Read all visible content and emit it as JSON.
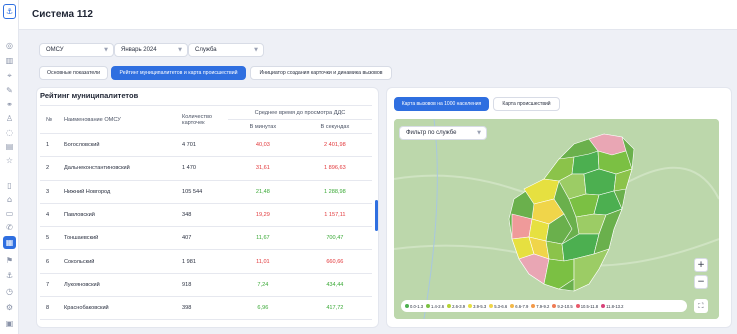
{
  "app": {
    "title": "Система 112"
  },
  "filters": [
    {
      "value": "ОМСУ"
    },
    {
      "value": "Январь 2024"
    },
    {
      "value": "Служба"
    }
  ],
  "tabs": [
    {
      "label": "Основные показатели",
      "active": false
    },
    {
      "label": "Рейтинг муниципалитетов и карта происшествий",
      "active": true
    },
    {
      "label": "Инициатор создания карточки и динамика вызовов",
      "active": false
    }
  ],
  "rating": {
    "title": "Рейтинг муниципалитетов",
    "headers": {
      "no": "№",
      "name": "Наименование ОМСУ",
      "count": "Количество карточек",
      "avg_group": "Среднее время до просмотра ДДС",
      "minutes": "В минутах",
      "seconds": "В секундах"
    },
    "rows": [
      {
        "no": "1",
        "name": "Богословский",
        "count": "4 701",
        "minutes": "40,03",
        "seconds": "2 401,98",
        "tone": "red"
      },
      {
        "no": "2",
        "name": "Дальнеконстантиновский",
        "count": "1 470",
        "minutes": "31,61",
        "seconds": "1 896,63",
        "tone": "red"
      },
      {
        "no": "3",
        "name": "Нижний Новгород",
        "count": "105 544",
        "minutes": "21,48",
        "seconds": "1 288,98",
        "tone": "green"
      },
      {
        "no": "4",
        "name": "Павловский",
        "count": "348",
        "minutes": "19,29",
        "seconds": "1 157,11",
        "tone": "red"
      },
      {
        "no": "5",
        "name": "Тоншаевский",
        "count": "407",
        "minutes": "11,67",
        "seconds": "700,47",
        "tone": "green"
      },
      {
        "no": "6",
        "name": "Сокольский",
        "count": "1 981",
        "minutes": "11,01",
        "seconds": "660,66",
        "tone": "red"
      },
      {
        "no": "7",
        "name": "Лукояновский",
        "count": "918",
        "minutes": "7,24",
        "seconds": "434,44",
        "tone": "green"
      },
      {
        "no": "8",
        "name": "Краснобаковский",
        "count": "398",
        "minutes": "6,96",
        "seconds": "417,72",
        "tone": "green"
      }
    ]
  },
  "map": {
    "tabs": [
      {
        "label": "Карта вызовов на 1000 населения",
        "active": true
      },
      {
        "label": "Карта происшествий",
        "active": false
      }
    ],
    "filter": "Фильтр по службе",
    "zoom_in": "+",
    "zoom_out": "−",
    "legend": [
      {
        "label": "0.0-1.3",
        "color": "#4caf50"
      },
      {
        "label": "1.4-2.6",
        "color": "#7bc043"
      },
      {
        "label": "2.6-3.9",
        "color": "#b5d334"
      },
      {
        "label": "3.9-5.3",
        "color": "#e6e040"
      },
      {
        "label": "5.3-6.6",
        "color": "#f0d54a"
      },
      {
        "label": "6.6-7.9",
        "color": "#f2b84a"
      },
      {
        "label": "7.9-9.2",
        "color": "#f39a4a"
      },
      {
        "label": "9.2-10.5",
        "color": "#ef7b55"
      },
      {
        "label": "10.5-11.8",
        "color": "#e85a6a"
      },
      {
        "label": "11.8-13.2",
        "color": "#d8437a"
      }
    ]
  }
}
